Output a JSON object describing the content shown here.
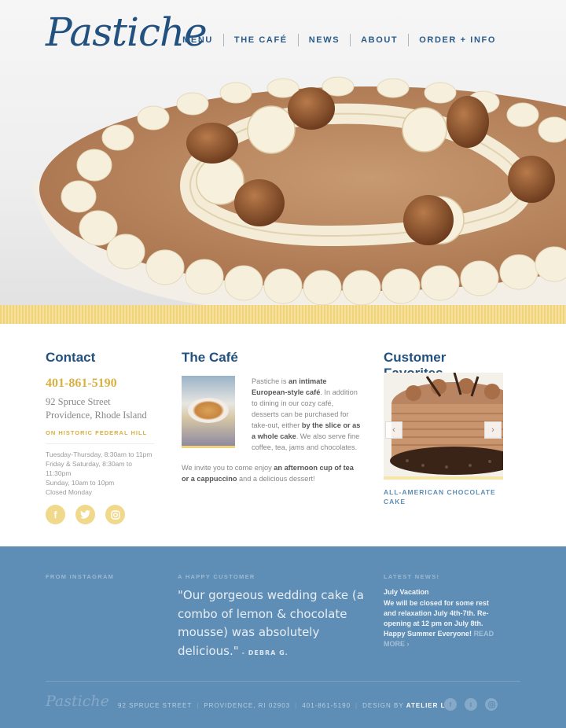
{
  "brand": {
    "logo_text": "Pastiche"
  },
  "nav": {
    "items": [
      "MENU",
      "THE CAFÉ",
      "NEWS",
      "ABOUT",
      "ORDER + INFO"
    ]
  },
  "contact": {
    "title": "Contact",
    "phone": "401-861-5190",
    "address_line1": "92 Spruce Street",
    "address_line2": "Providence, Rhode Island",
    "neighborhood": "ON HISTORIC FEDERAL HILL",
    "hours": [
      "Tuesday-Thursday, 8:30am to 11pm",
      "Friday & Saturday, 8:30am to 11:30pm",
      "Sunday, 10am to 10pm",
      "Closed Monday"
    ],
    "social_icons": [
      "facebook-icon",
      "twitter-icon",
      "instagram-icon"
    ]
  },
  "cafe": {
    "title": "The Café",
    "p1_a": "Pastiche is ",
    "p1_b": "an intimate European-style café",
    "p1_c": ". In addition to dining in our cozy café, desserts can be purchased for take-out, either ",
    "p1_d": "by the slice or as a whole cake",
    "p1_e": ". We also serve fine coffee, tea, jams and chocolates.",
    "p2_a": "We invite you to come enjoy ",
    "p2_b": "an afternoon cup of tea or a cappuccino",
    "p2_c": " and a delicious dessert!"
  },
  "favorites": {
    "title": "Customer Favorites",
    "caption": "ALL-AMERICAN CHOCOLATE CAKE",
    "prev_arrow": "‹",
    "next_arrow": "›"
  },
  "footer": {
    "instagram_heading": "FROM INSTAGRAM",
    "customer_heading": "A HAPPY CUSTOMER",
    "quote": "\"Our gorgeous wedding cake (a combo of lemon & chocolate mousse) was absolutely delicious.\"",
    "quote_author": "- DEBRA G.",
    "news_heading": "LATEST NEWS!",
    "news_title": "July Vacation",
    "news_body": "We will be closed for some rest and relaxation July 4th-7th. Re-opening at 12 pm on July 8th. Happy Summer Everyone!",
    "news_more": "READ MORE ›",
    "logo_text": "Pastiche",
    "address": "92 SPRUCE STREET",
    "city": "PROVIDENCE, RI 02903",
    "phone": "401-861-5190",
    "design_by": "DESIGN BY",
    "designer": "ATELIER LKS"
  },
  "colors": {
    "brand_blue": "#22507f",
    "gold": "#d9b043",
    "footer_blue": "#5e8db5",
    "stripe_yellow": "#f1d37a"
  }
}
